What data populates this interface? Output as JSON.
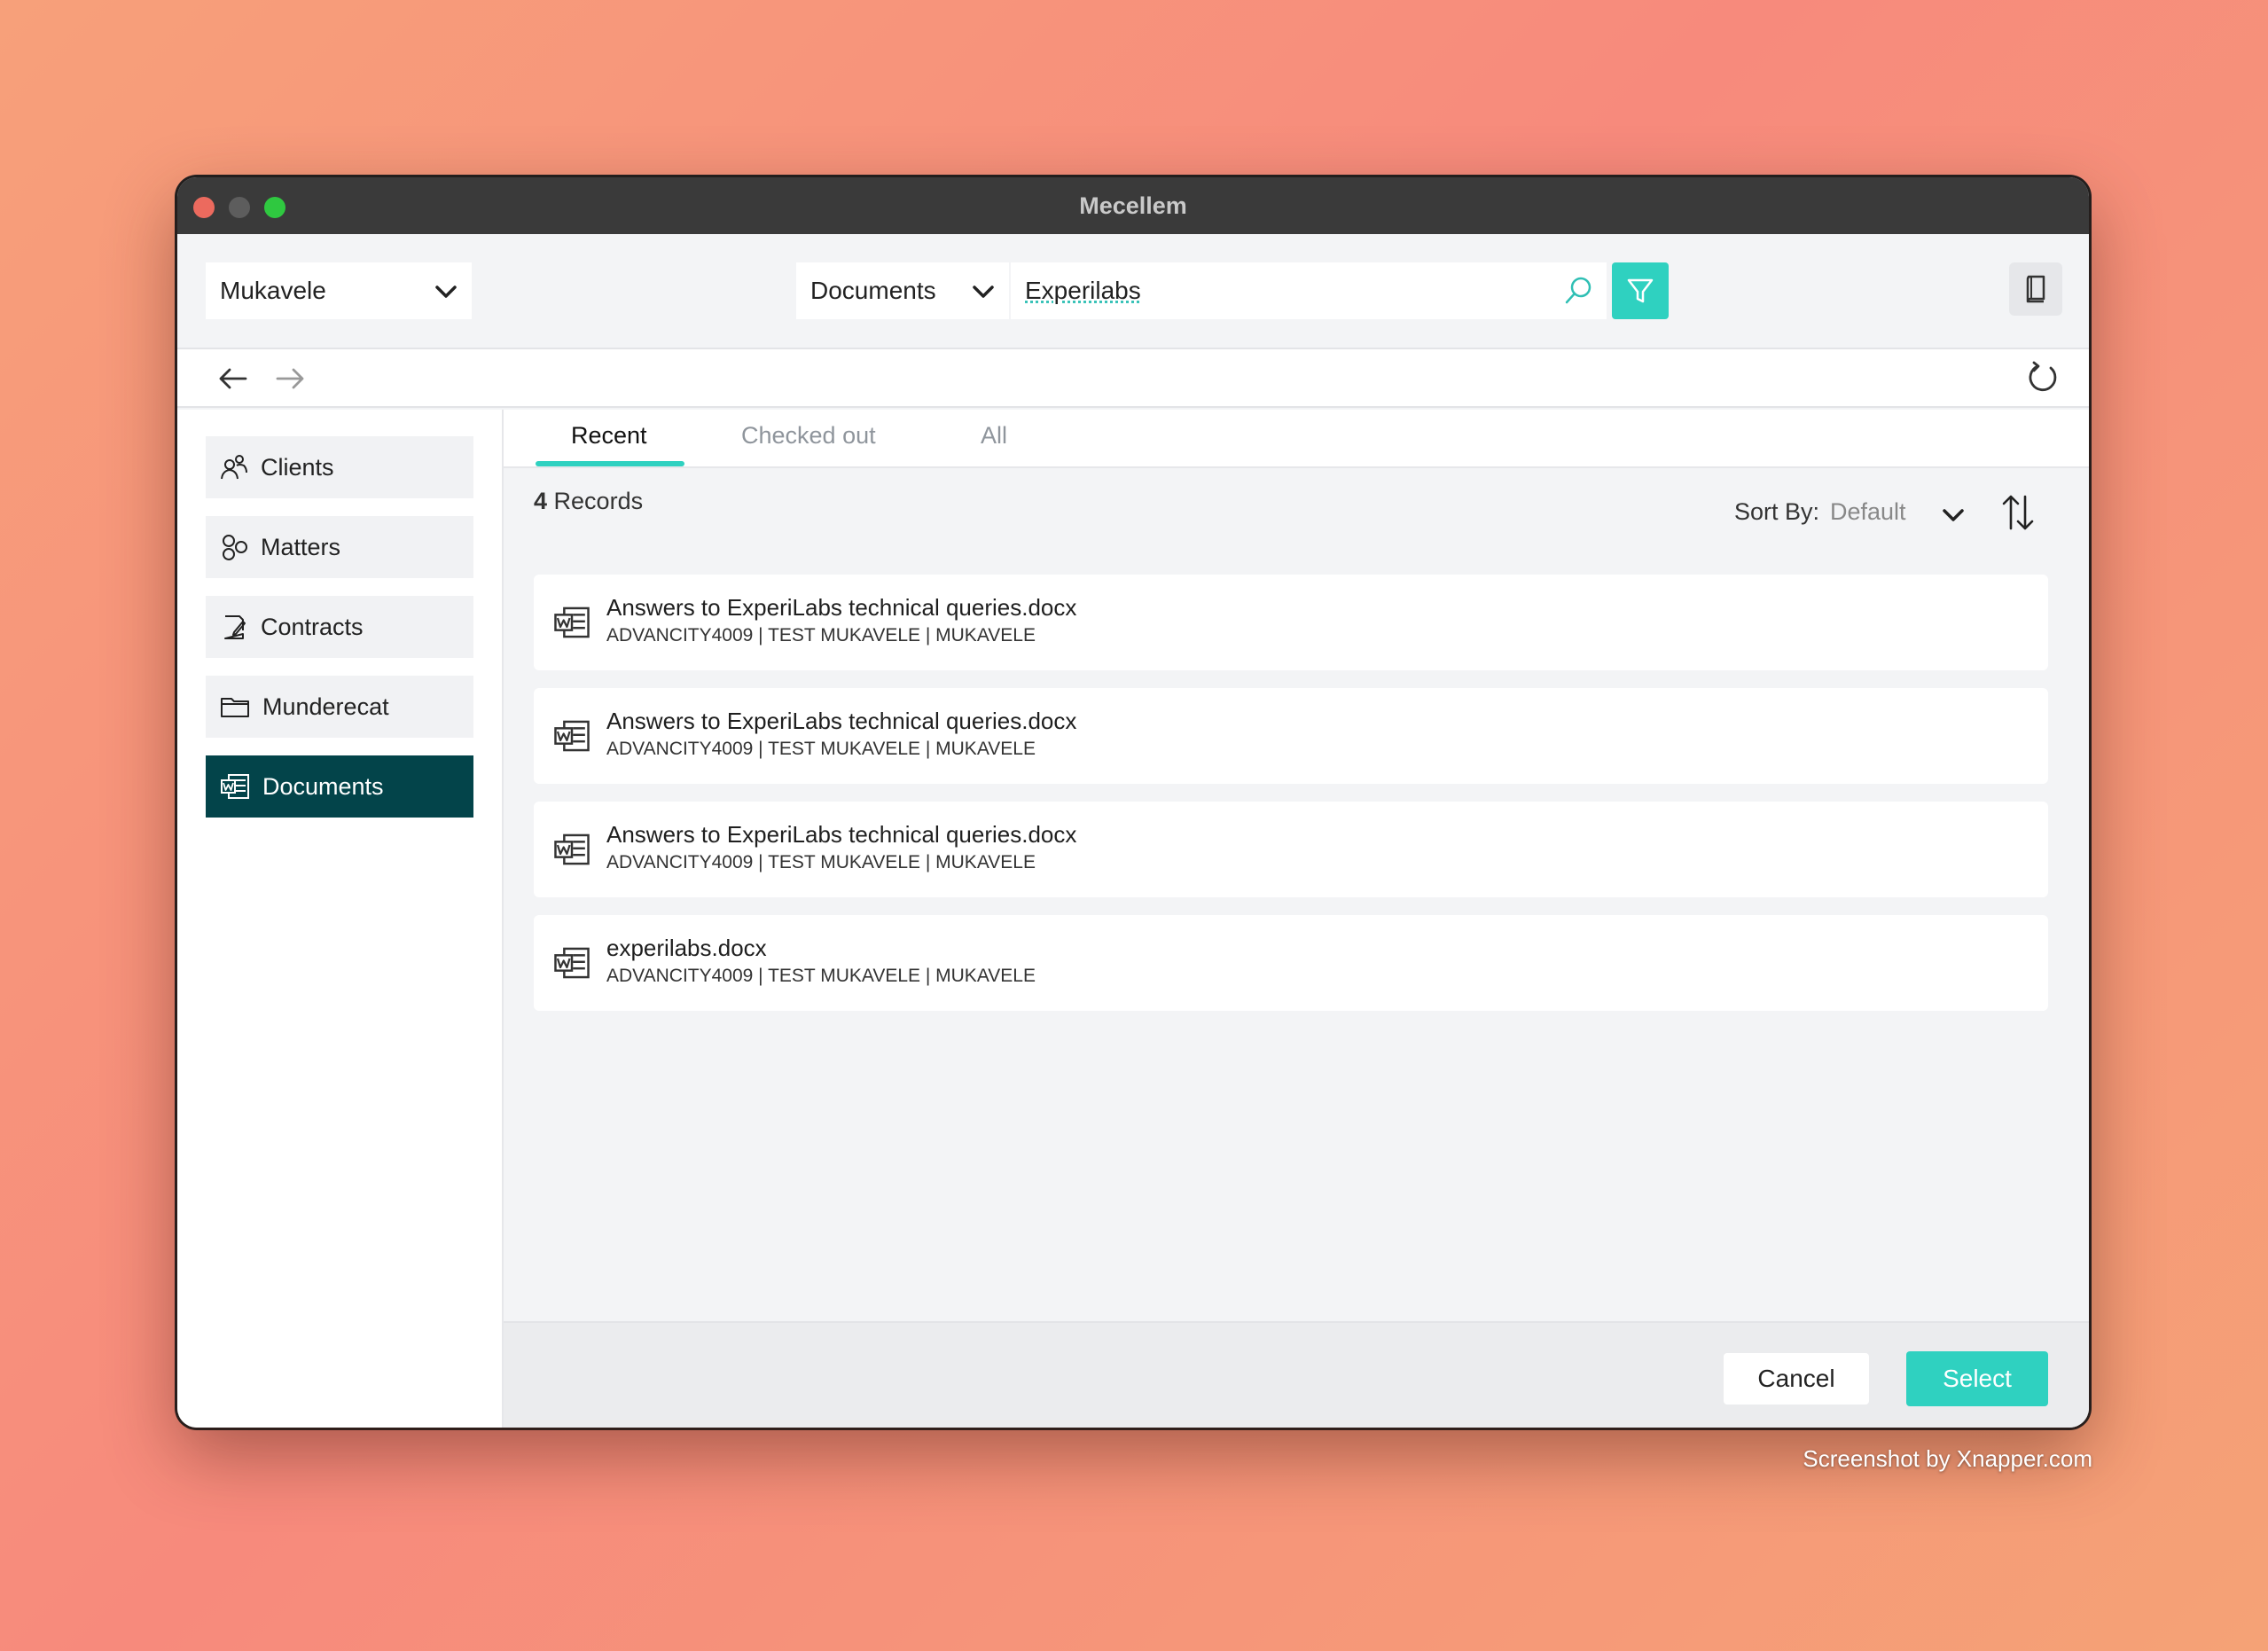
{
  "window": {
    "title": "Mecellem"
  },
  "toolbar": {
    "client_select": "Mukavele",
    "type_select": "Documents",
    "search_value": "Experilabs"
  },
  "sidebar": {
    "items": [
      {
        "label": "Clients",
        "icon": "users-icon"
      },
      {
        "label": "Matters",
        "icon": "circles-icon"
      },
      {
        "label": "Contracts",
        "icon": "contract-icon"
      },
      {
        "label": "Munderecat",
        "icon": "folder-icon"
      },
      {
        "label": "Documents",
        "icon": "word-doc-icon",
        "active": true
      }
    ]
  },
  "tabs": [
    {
      "label": "Recent",
      "active": true
    },
    {
      "label": "Checked out"
    },
    {
      "label": "All"
    }
  ],
  "records": {
    "count": "4",
    "label": "Records"
  },
  "sort": {
    "label": "Sort By:",
    "value": "Default"
  },
  "documents": [
    {
      "title": "Answers to ExperiLabs technical queries.docx",
      "meta": "ADVANCITY4009 | TEST MUKAVELE | MUKAVELE"
    },
    {
      "title": "Answers to ExperiLabs technical queries.docx",
      "meta": "ADVANCITY4009 | TEST MUKAVELE | MUKAVELE"
    },
    {
      "title": "Answers to ExperiLabs technical queries.docx",
      "meta": "ADVANCITY4009 | TEST MUKAVELE | MUKAVELE"
    },
    {
      "title": "experilabs.docx",
      "meta": "ADVANCITY4009 | TEST MUKAVELE | MUKAVELE"
    }
  ],
  "footer": {
    "cancel_label": "Cancel",
    "select_label": "Select"
  },
  "watermark": "Screenshot by Xnapper.com",
  "colors": {
    "accent": "#2fd1c0",
    "active_nav": "#03444a",
    "titlebar": "#3a3a3a"
  }
}
